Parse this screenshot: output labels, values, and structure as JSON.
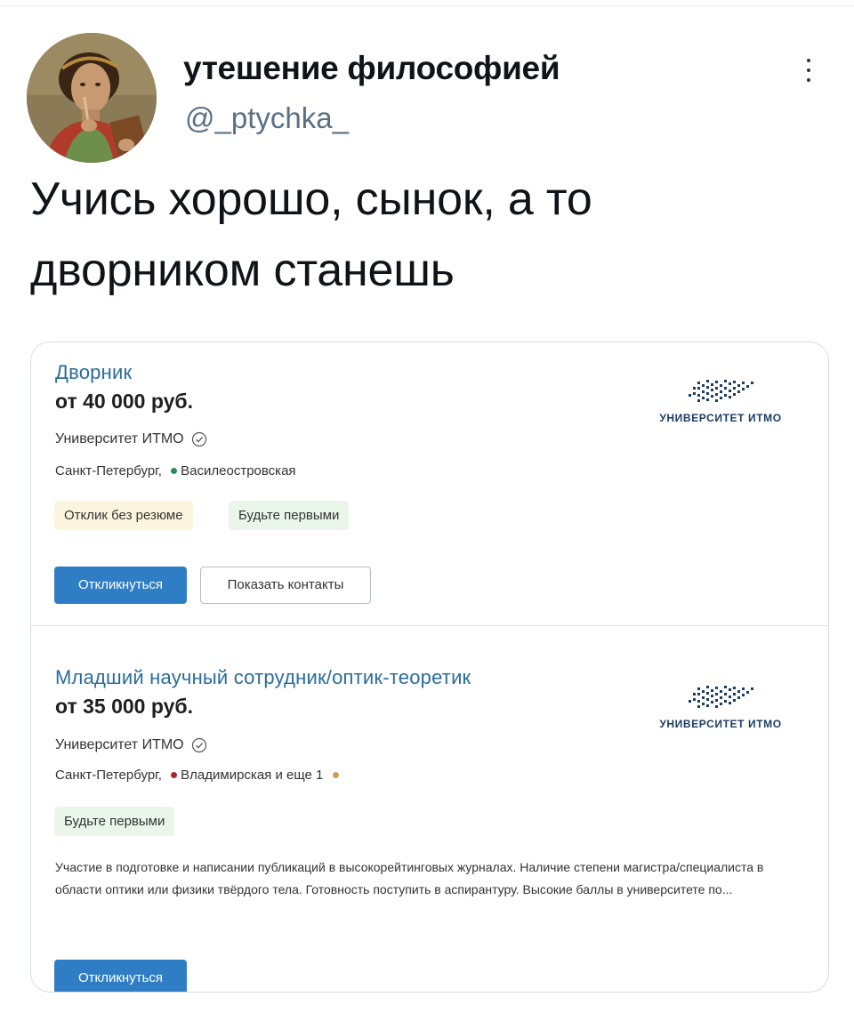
{
  "tweet": {
    "display_name": "утешение философией",
    "handle": "@_ptychka_",
    "text": "Учись хорошо, сынок, а то дворником станешь",
    "more_icon": "vertical-ellipsis-icon",
    "avatar_icon": "avatar-portrait"
  },
  "card": {
    "vacancies": [
      {
        "title": "Дворник",
        "salary": "от 40 000 руб.",
        "company": "Университет ИТМО",
        "city": "Санкт-Петербург,",
        "metro": "Василеостровская",
        "metro_color": "#2e8b57",
        "extra_metro": "",
        "tags": [
          "Отклик без резюме",
          "Будьте первыми"
        ],
        "description": "",
        "respond_label": "Откликнуться",
        "contacts_label": "Показать контакты",
        "logo_text": "УНИВЕРСИТЕТ ИТМО"
      },
      {
        "title": "Младший научный сотрудник/оптик-теоретик",
        "salary": "от 35 000 руб.",
        "company": "Университет ИТМО",
        "city": "Санкт-Петербург,",
        "metro": "Владимирская и еще 1",
        "metro_color": "#b0232a",
        "extra_metro_color": "#c8a15a",
        "tags": [
          "Будьте первыми"
        ],
        "description": "Участие в подготовке и написании публикаций в высокорейтинговых журналах. Наличие степени магистра/специалиста в области оптики или физики твёрдого тела. Готовность поступить в аспирантуру. Высокие баллы в университете по...",
        "respond_label": "Откликнуться",
        "logo_text": "УНИВЕРСИТЕТ ИТМО"
      }
    ]
  },
  "colors": {
    "link_blue": "#2a6d9a",
    "button_blue": "#2f7ec5",
    "handle_gray": "#5b7083"
  }
}
